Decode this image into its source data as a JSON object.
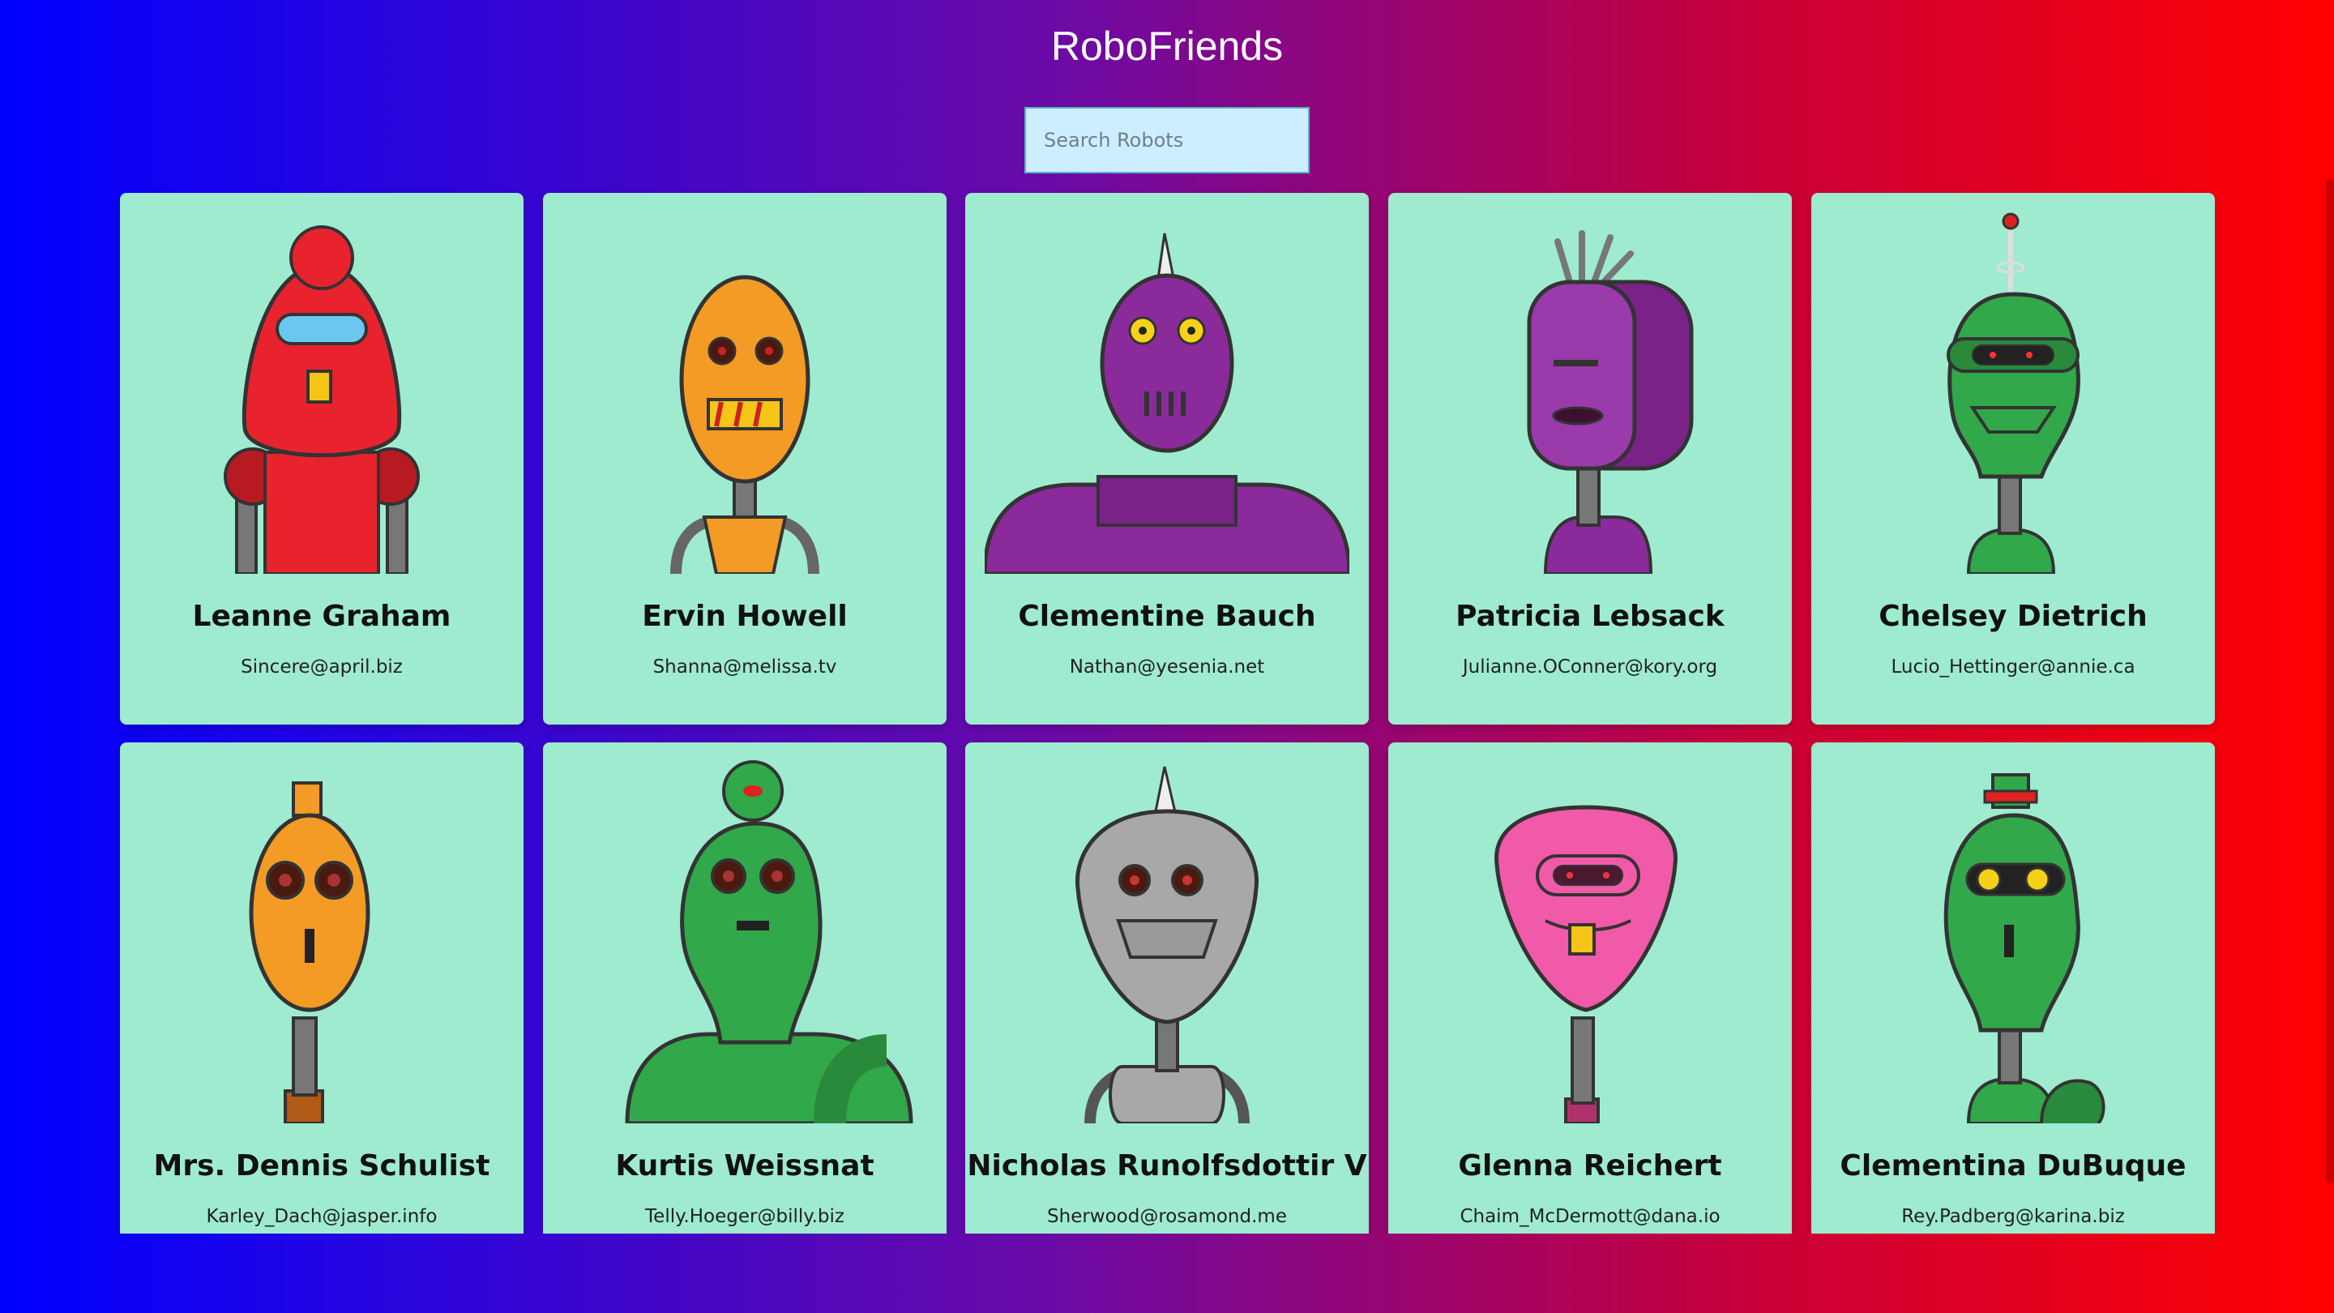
{
  "app": {
    "title": "RoboFriends"
  },
  "search": {
    "placeholder": "Search Robots",
    "value": ""
  },
  "robots": [
    {
      "name": "Leanne Graham",
      "email": "Sincere@april.biz",
      "color": "#e8232e",
      "icon": "red-robot-avatar"
    },
    {
      "name": "Ervin Howell",
      "email": "Shanna@melissa.tv",
      "color": "#f39b24",
      "icon": "orange-robot-avatar"
    },
    {
      "name": "Clementine Bauch",
      "email": "Nathan@yesenia.net",
      "color": "#8b2a9b",
      "icon": "purple-robot-avatar"
    },
    {
      "name": "Patricia Lebsack",
      "email": "Julianne.OConner@kory.org",
      "color": "#8b2a9b",
      "icon": "purple-robot-avatar"
    },
    {
      "name": "Chelsey Dietrich",
      "email": "Lucio_Hettinger@annie.ca",
      "color": "#31a84a",
      "icon": "green-robot-avatar"
    },
    {
      "name": "Mrs. Dennis Schulist",
      "email": "Karley_Dach@jasper.info",
      "color": "#f39b24",
      "icon": "orange-robot-avatar"
    },
    {
      "name": "Kurtis Weissnat",
      "email": "Telly.Hoeger@billy.biz",
      "color": "#31a84a",
      "icon": "green-robot-avatar"
    },
    {
      "name": "Nicholas Runolfsdottir V",
      "email": "Sherwood@rosamond.me",
      "color": "#a8a8a8",
      "icon": "gray-robot-avatar"
    },
    {
      "name": "Glenna Reichert",
      "email": "Chaim_McDermott@dana.io",
      "color": "#f15aa8",
      "icon": "pink-robot-avatar"
    },
    {
      "name": "Clementina DuBuque",
      "email": "Rey.Padberg@karina.biz",
      "color": "#31a84a",
      "icon": "green-robot-avatar"
    }
  ]
}
